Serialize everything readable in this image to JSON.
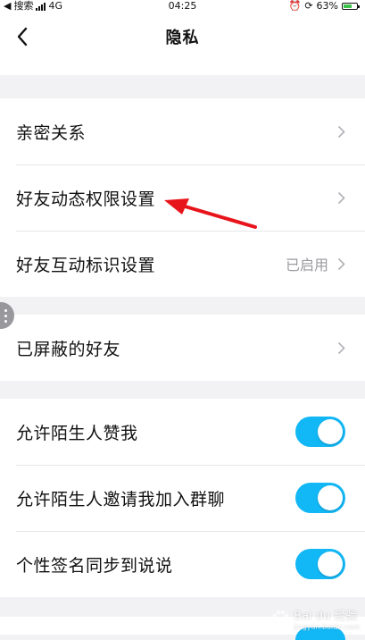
{
  "status_bar": {
    "back_app": "搜索",
    "network": "4G",
    "time": "04:25",
    "battery_percent": "63%",
    "battery_level": 0.63
  },
  "header": {
    "title": "隐私"
  },
  "groups": [
    {
      "rows": [
        {
          "label": "亲密关系"
        },
        {
          "label": "好友动态权限设置"
        },
        {
          "label": "好友互动标识设置",
          "status": "已启用"
        }
      ]
    },
    {
      "rows": [
        {
          "label": "已屏蔽的好友"
        }
      ]
    },
    {
      "rows": [
        {
          "label": "允许陌生人赞我",
          "toggle_on": true
        },
        {
          "label": "允许陌生人邀请我加入群聊",
          "toggle_on": true
        },
        {
          "label": "个性签名同步到说说",
          "toggle_on": true
        }
      ]
    }
  ],
  "watermark": {
    "text": "Bai du 经验",
    "sub": "jingyan.baidu.com"
  },
  "colors": {
    "toggle_on": "#12b7f5",
    "annotation_arrow": "#e8141b",
    "chevron": "#b0b0b5"
  }
}
